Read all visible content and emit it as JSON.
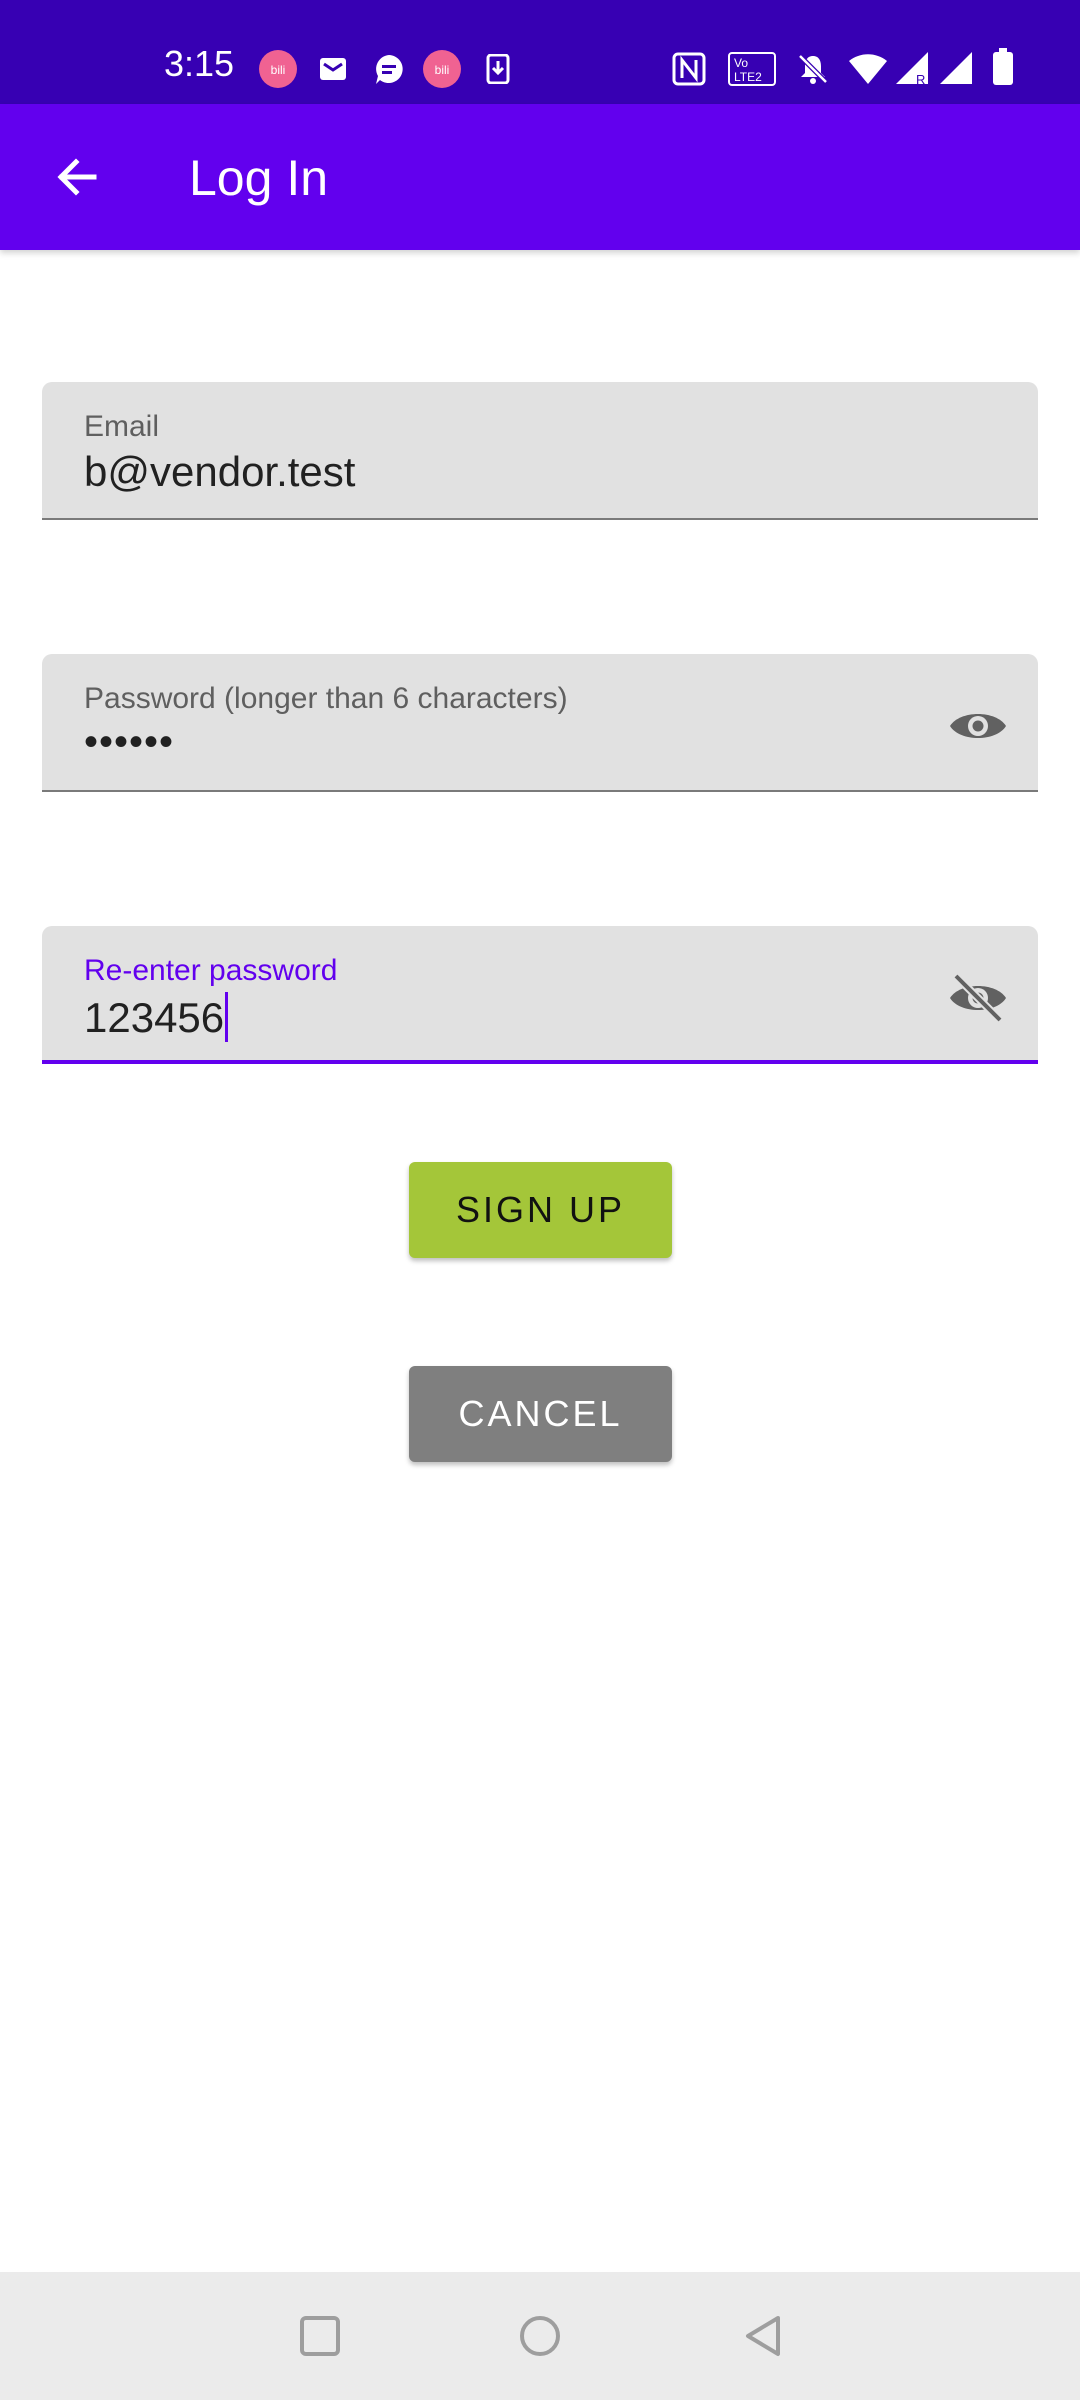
{
  "status_bar": {
    "time": "3:15",
    "left_icons": [
      "bubble-app-icon",
      "mail-icon",
      "chat-icon",
      "bubble-app-icon",
      "download-icon"
    ],
    "right_icons": [
      "nfc-icon",
      "volte-icon",
      "mute-icon",
      "wifi-icon",
      "signal-icon",
      "signal-icon",
      "battery-icon"
    ],
    "background": "#3700b3"
  },
  "app_bar": {
    "title": "Log In",
    "back_icon": "arrow-back-icon",
    "background": "#6200ee"
  },
  "form": {
    "email": {
      "label": "Email",
      "value": "b@vendor.test"
    },
    "password": {
      "label": "Password (longer than 6 characters)",
      "value": "••••••",
      "toggle_icon": "eye-icon"
    },
    "reenter_password": {
      "label": "Re-enter password",
      "value": "123456",
      "toggle_icon": "eye-off-icon",
      "focused": true
    },
    "accent_color": "#6200ee"
  },
  "buttons": {
    "signup_label": "SIGN UP",
    "signup_color": "#a4c639",
    "cancel_label": "CANCEL",
    "cancel_color": "#7f7f7f"
  },
  "nav_bar": {
    "icons": [
      "recents-icon",
      "home-icon",
      "back-icon"
    ]
  }
}
